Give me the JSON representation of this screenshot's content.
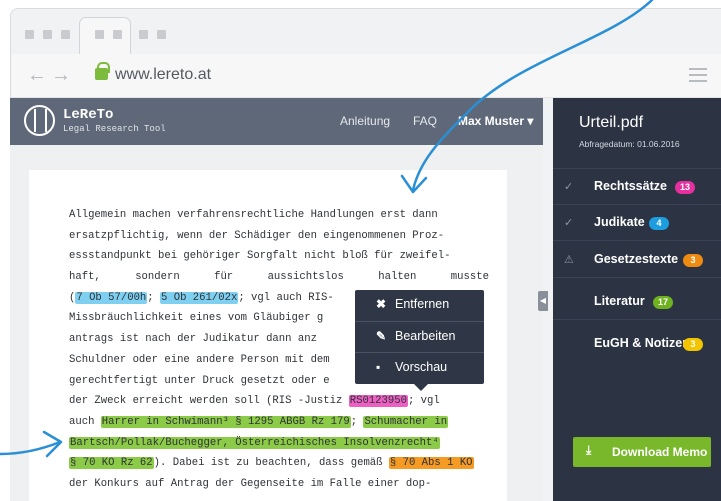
{
  "browser": {
    "url": "www.lereto.at",
    "back_glyph": "←",
    "forward_glyph": "→"
  },
  "app": {
    "logo_title": "LeReTo",
    "logo_subtitle": "Legal Research Tool",
    "nav": [
      {
        "label": "Anleitung"
      },
      {
        "label": "FAQ"
      },
      {
        "label": "Max Muster ▾"
      }
    ]
  },
  "document": {
    "lines": [
      {
        "text": "Allgemein machen verfahrensrechtliche Handlungen erst dann"
      },
      {
        "text": "ersatzpflichtig, wenn der Schädiger den eingenommenen Proz-"
      },
      {
        "text": "essstandpunkt bei gehöriger Sorgfalt nicht bloß für zweifel-"
      },
      {
        "words": [
          "haft,",
          "sondern",
          "für",
          "aussichtslos",
          "halten",
          "musste"
        ]
      }
    ],
    "citations": {
      "c1": "7 Ob 57/00h",
      "c2": "5 Ob 261/02x",
      "line5_tail": "; vgl auch RIS-",
      "line6": "Missbräuchlichkeit eines vom Gläubiger g",
      "line7": "antrags ist nach der Judikatur dann anz",
      "line8": "Schuldner oder eine andere Person mit dem",
      "line9": "gerechtfertigt unter Druck gesetzt oder e",
      "line10_pre": "der Zweck erreicht werden soll (RIS -Justiz ",
      "ris": "RS0123950",
      "line10_post": "; vgl",
      "line11_pre": "auch ",
      "harrer": "Harrer in Schwimann³ § 1295 ABGB Rz 179",
      "schumacher1": "Schumacher in",
      "schumacher2": "Bartsch/Pollak/Buchegger, Österreichisches Insolvenzrecht⁴",
      "schumacher3": "§ 70 KO Rz 62",
      "line13_mid": "). Dabei ist zu beachten, dass gemäß ",
      "ko": "§ 70 Abs 1 KO",
      "line14": "der Konkurs auf Antrag der Gegenseite im Falle einer dop-"
    },
    "highlight_colors": {
      "rechtssaetze": "#ee5fc4",
      "judikate": "#7fd0f0",
      "literatur": "#8ccb48",
      "gesetzestexte": "#f59a22"
    }
  },
  "context_menu": {
    "items": [
      {
        "label": "Entfernen",
        "icon": "✖"
      },
      {
        "label": "Bearbeiten",
        "icon": "✎"
      },
      {
        "label": "Vorschau",
        "icon": "▪"
      }
    ]
  },
  "sidebar": {
    "file_name": "Urteil.pdf",
    "query_date": "Abfragedatum: 01.06.2016",
    "items": [
      {
        "label": "Rechtssätze",
        "count": "13",
        "mark": "✓",
        "color": "#e7309f"
      },
      {
        "label": "Judikate",
        "count": "4",
        "mark": "✓",
        "color": "#1d9de0"
      },
      {
        "label": "Gesetzestexte",
        "count": "3",
        "mark": "⚠",
        "color": "#f08b12"
      },
      {
        "label": "Literatur",
        "count": "17",
        "mark": "",
        "color": "#6fb21f"
      },
      {
        "label": "EuGH & Notizen",
        "count": "3",
        "mark": "",
        "color": "#f2c500"
      }
    ],
    "download_label": "Download Memo",
    "download_icon": "⤓"
  },
  "colors": {
    "header": "#5f6878",
    "sidebar": "#2c3444",
    "annotation_arrow": "#2b8fd6",
    "download": "#78b82a"
  }
}
